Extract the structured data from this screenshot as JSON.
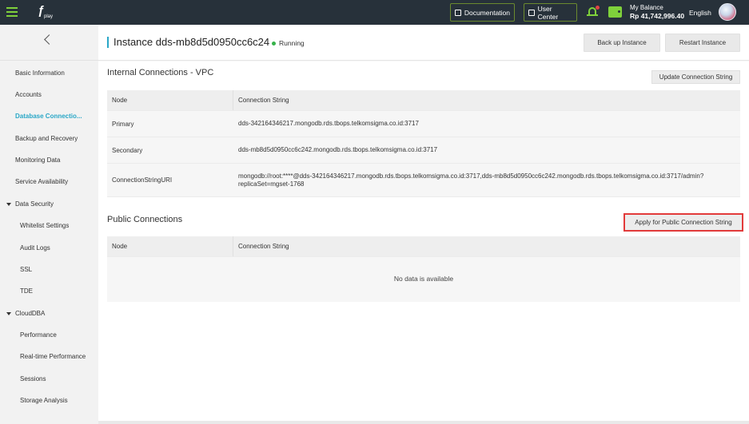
{
  "topbar": {
    "logo_text": "play",
    "documentation_label": "Documentation",
    "user_center_label": "User Center",
    "balance_label": "My Balance",
    "balance_value": "Rp 41,742,996.40",
    "language": "English"
  },
  "sidebar": {
    "items": [
      {
        "label": "Basic Information"
      },
      {
        "label": "Accounts"
      },
      {
        "label": "Database Connectio..."
      },
      {
        "label": "Backup and Recovery"
      },
      {
        "label": "Monitoring Data"
      },
      {
        "label": "Service Availability"
      },
      {
        "label": "Data Security"
      },
      {
        "label": "Whitelist Settings"
      },
      {
        "label": "Audit Logs"
      },
      {
        "label": "SSL"
      },
      {
        "label": "TDE"
      },
      {
        "label": "CloudDBA"
      },
      {
        "label": "Performance"
      },
      {
        "label": "Real-time Performance"
      },
      {
        "label": "Sessions"
      },
      {
        "label": "Storage Analysis"
      }
    ]
  },
  "header": {
    "title": "Instance dds-mb8d5d0950cc6c24",
    "status": "Running",
    "backup_label": "Back up Instance",
    "restart_label": "Restart Instance"
  },
  "internal": {
    "title": "Internal Connections - VPC",
    "update_label": "Update Connection String",
    "columns": [
      "Node",
      "Connection String"
    ],
    "rows": [
      {
        "node": "Primary",
        "conn": "dds-342164346217.mongodb.rds.tbops.telkomsigma.co.id:3717"
      },
      {
        "node": "Secondary",
        "conn": "dds-mb8d5d0950cc6c242.mongodb.rds.tbops.telkomsigma.co.id:3717"
      },
      {
        "node": "ConnectionStringURI",
        "conn": "mongodb://root:****@dds-342164346217.mongodb.rds.tbops.telkomsigma.co.id:3717,dds-mb8d5d0950cc6c242.mongodb.rds.tbops.telkomsigma.co.id:3717/admin?replicaSet=mgset-1768"
      }
    ]
  },
  "public": {
    "title": "Public Connections",
    "apply_label": "Apply for Public Connection String",
    "columns": [
      "Node",
      "Connection String"
    ],
    "empty_text": "No data is available"
  },
  "colors": {
    "topbar_bg": "#27313a",
    "accent_green": "#7fd13b",
    "active_link": "#2aa7c7",
    "running_dot": "#36b24a",
    "highlight_border": "#e23a3a"
  }
}
